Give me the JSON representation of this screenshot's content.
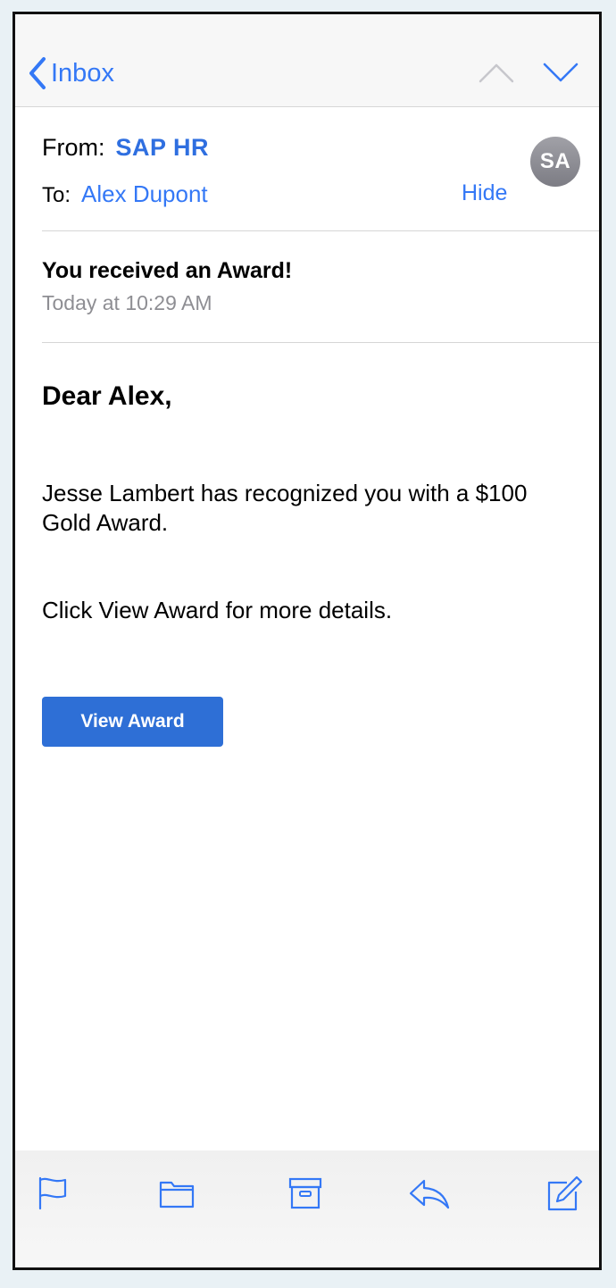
{
  "nav": {
    "back_label": "Inbox",
    "icons": [
      "chevron-left-icon",
      "chevron-up-icon",
      "chevron-down-icon"
    ]
  },
  "header": {
    "from_label": "From:",
    "from_name": "SAP HR",
    "to_label": "To:",
    "to_name": "Alex Dupont",
    "hide_label": "Hide",
    "avatar_initials": "SA"
  },
  "message": {
    "subject": "You received an Award!",
    "date": "Today at 10:29 AM",
    "greeting": "Dear Alex,",
    "paragraph1": "Jesse Lambert has recognized you with a $100 Gold Award.",
    "paragraph2": "Click View Award for more details.",
    "button_label": "View Award"
  },
  "toolbar": {
    "icons": [
      "flag-icon",
      "folder-icon",
      "archive-icon",
      "reply-icon",
      "compose-icon"
    ]
  },
  "colors": {
    "accent": "#3478f6",
    "button": "#2e6fd6",
    "secondary_text": "#8e8e93",
    "background": "#e9f1f5"
  }
}
